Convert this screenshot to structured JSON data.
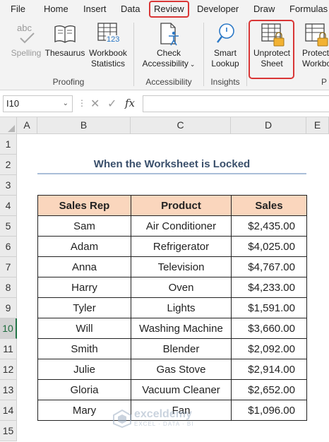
{
  "menu": {
    "tabs": [
      {
        "label": "File"
      },
      {
        "label": "Home"
      },
      {
        "label": "Insert"
      },
      {
        "label": "Data"
      },
      {
        "label": "Review"
      },
      {
        "label": "Developer"
      },
      {
        "label": "Draw"
      },
      {
        "label": "Formulas"
      }
    ],
    "highlighted_tab": "Review"
  },
  "ribbon": {
    "proofing": {
      "spelling": {
        "label_line1": "Spelling",
        "icon_text": "abc"
      },
      "thesaurus": {
        "label": "Thesaurus"
      },
      "workbook_statistics": {
        "label_line1": "Workbook",
        "label_line2": "Statistics",
        "icon_number": "123"
      },
      "group_label": "Proofing"
    },
    "accessibility": {
      "check_accessibility": {
        "label_line1": "Check",
        "label_line2": "Accessibility"
      },
      "group_label": "Accessibility"
    },
    "insights": {
      "smart_lookup": {
        "label_line1": "Smart",
        "label_line2": "Lookup"
      },
      "group_label": "Insights"
    },
    "protect": {
      "unprotect_sheet": {
        "label_line1": "Unprotect",
        "label_line2": "Sheet"
      },
      "protect_workbook": {
        "label_line1": "Protect",
        "label_line2": "Workbook"
      },
      "group_label": "P"
    }
  },
  "formula_bar": {
    "name_box": "I10",
    "fx_symbol": "fx",
    "formula": ""
  },
  "grid": {
    "columns": [
      "A",
      "B",
      "C",
      "D",
      "E"
    ],
    "rows": [
      "1",
      "2",
      "3",
      "4",
      "5",
      "6",
      "7",
      "8",
      "9",
      "10",
      "11",
      "12",
      "13",
      "14",
      "15"
    ],
    "selected_row": "10"
  },
  "sheet": {
    "title": "When the Worksheet is Locked",
    "headers": [
      "Sales Rep",
      "Product",
      "Sales"
    ],
    "rows": [
      [
        "Sam",
        "Air Conditioner",
        "$2,435.00"
      ],
      [
        "Adam",
        "Refrigerator",
        "$4,025.00"
      ],
      [
        "Anna",
        "Television",
        "$4,767.00"
      ],
      [
        "Harry",
        "Oven",
        "$4,233.00"
      ],
      [
        "Tyler",
        "Lights",
        "$1,591.00"
      ],
      [
        "Will",
        "Washing Machine",
        "$3,660.00"
      ],
      [
        "Smith",
        "Blender",
        "$2,092.00"
      ],
      [
        "Julie",
        "Gas Stove",
        "$2,914.00"
      ],
      [
        "Gloria",
        "Vacuum Cleaner",
        "$2,652.00"
      ],
      [
        "Mary",
        "Fan",
        "$1,096.00"
      ]
    ]
  },
  "watermark": {
    "name": "exceldemy",
    "tagline": "EXCEL · DATA · BI"
  },
  "colors": {
    "header_fill": "#fad6bd",
    "highlight_outline": "#d93636",
    "title_text": "#3a4f6b",
    "selected_row_accent": "#217346",
    "lock_icon": "#f2b233"
  }
}
